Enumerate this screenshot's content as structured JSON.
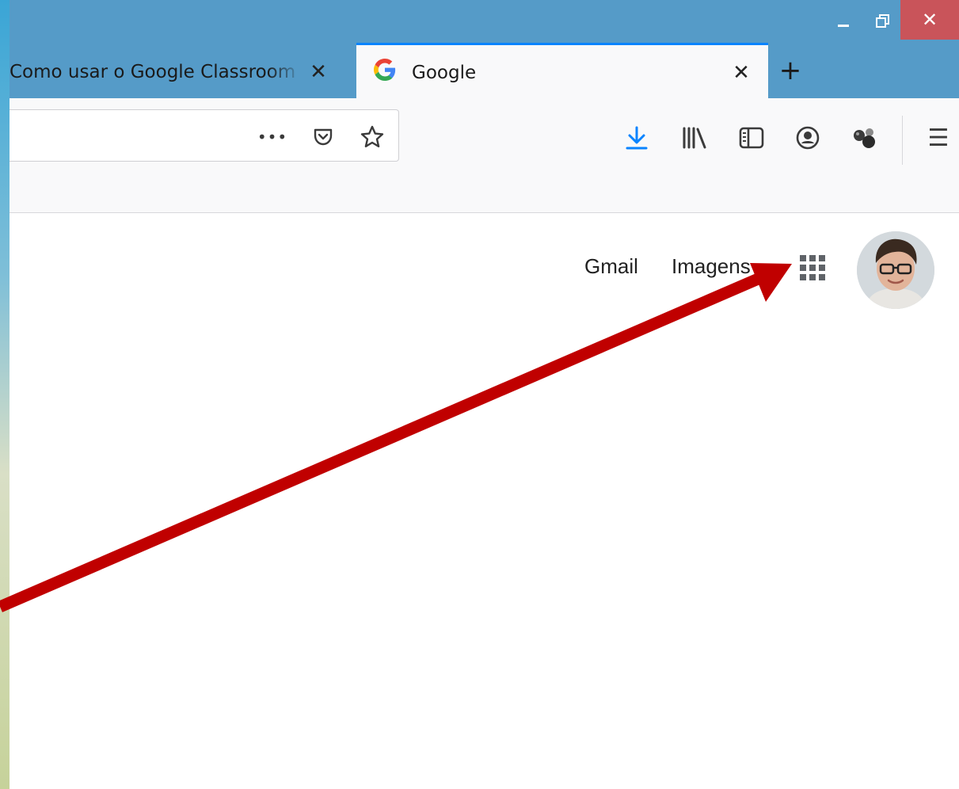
{
  "window": {
    "minimize_icon": "minimize-icon",
    "restore_icon": "restore-icon",
    "close_label": "✕"
  },
  "tabs": [
    {
      "title": "Como usar o Google Classroom",
      "active": false,
      "close_label": "✕"
    },
    {
      "title": "Google",
      "active": true,
      "favicon": "G",
      "close_label": "✕"
    }
  ],
  "new_tab_label": "+",
  "urlbar": {
    "value": "",
    "page_actions_label": "•••"
  },
  "toolbar": {
    "accent_color": "#0a84ff",
    "icons": [
      "download-icon",
      "library-icon",
      "sidebar-icon",
      "account-icon",
      "extension-icon",
      "menu-icon"
    ],
    "menu_label": "☰"
  },
  "google_header": {
    "gmail_label": "Gmail",
    "images_label": "Imagens"
  },
  "annotation": {
    "arrow_color": "#c00000"
  }
}
